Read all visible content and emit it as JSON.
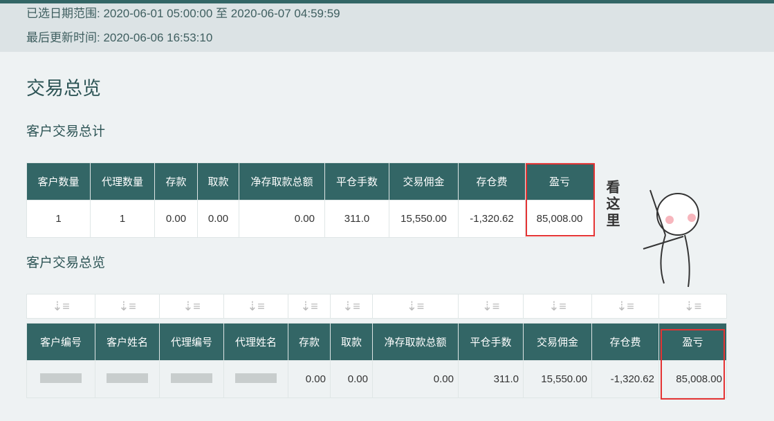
{
  "header": {
    "date_range": "已选日期范围: 2020-06-01 05:00:00 至 2020-06-07 04:59:59",
    "last_update": "最后更新时间: 2020-06-06 16:53:10"
  },
  "page_title": "交易总览",
  "summary": {
    "title": "客户交易总计",
    "columns": [
      "客户数量",
      "代理数量",
      "存款",
      "取款",
      "净存取款总额",
      "平仓手数",
      "交易佣金",
      "存仓费",
      "盈亏"
    ],
    "row": [
      "1",
      "1",
      "0.00",
      "0.00",
      "0.00",
      "311.0",
      "15,550.00",
      "-1,320.62",
      "85,008.00"
    ]
  },
  "detail": {
    "title": "客户交易总览",
    "columns": [
      "客户编号",
      "客户姓名",
      "代理编号",
      "代理姓名",
      "存款",
      "取款",
      "净存取款总额",
      "平仓手数",
      "交易佣金",
      "存仓费",
      "盈亏"
    ],
    "row": [
      "",
      "",
      "",
      "",
      "0.00",
      "0.00",
      "0.00",
      "311.0",
      "15,550.00",
      "-1,320.62",
      "85,008.00"
    ]
  },
  "sticker": "看这里"
}
